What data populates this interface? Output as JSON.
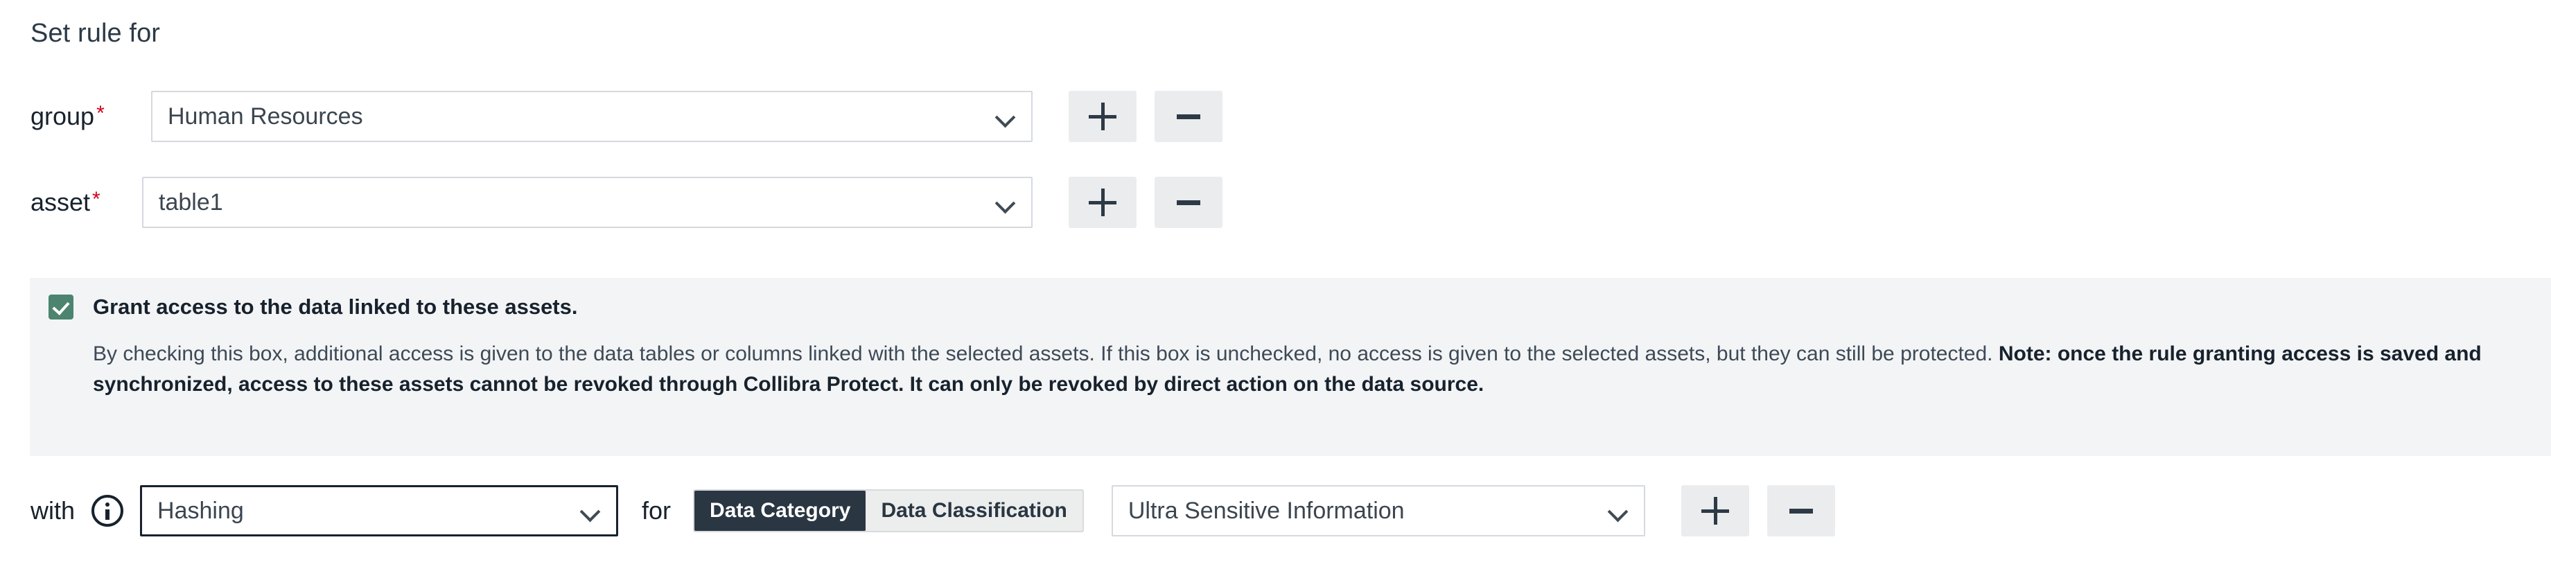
{
  "title": "Set rule for",
  "rows": {
    "group": {
      "label": "group",
      "required_mark": "*",
      "value": "Human Resources",
      "add_label": "+",
      "remove_label": "−"
    },
    "asset": {
      "label": "asset",
      "required_mark": "*",
      "value": "table1",
      "add_label": "+",
      "remove_label": "−"
    }
  },
  "grant_panel": {
    "checkbox_checked": true,
    "checkbox_label": "Grant access to the data linked to these assets.",
    "description_plain_1": "By checking this box, additional access is given to the data tables or columns linked with the selected assets. If this box is unchecked, no access is given to the selected assets, but they can still be protected. ",
    "description_bold": "Note: once the rule granting access is saved and synchronized, access to these assets cannot be revoked through Collibra Protect. It can only be revoked by direct action on the data source.",
    "accent_color": "#4c8470",
    "panel_color": "#f3f4f6"
  },
  "with_row": {
    "with_label": "with",
    "info_icon": "info-icon",
    "method_value": "Hashing",
    "for_label": "for",
    "segmented": {
      "options": [
        "Data Category",
        "Data Classification"
      ],
      "selected": "Data Category"
    },
    "classification_value": "Ultra Sensitive Information",
    "add_label": "+",
    "remove_label": "−"
  }
}
